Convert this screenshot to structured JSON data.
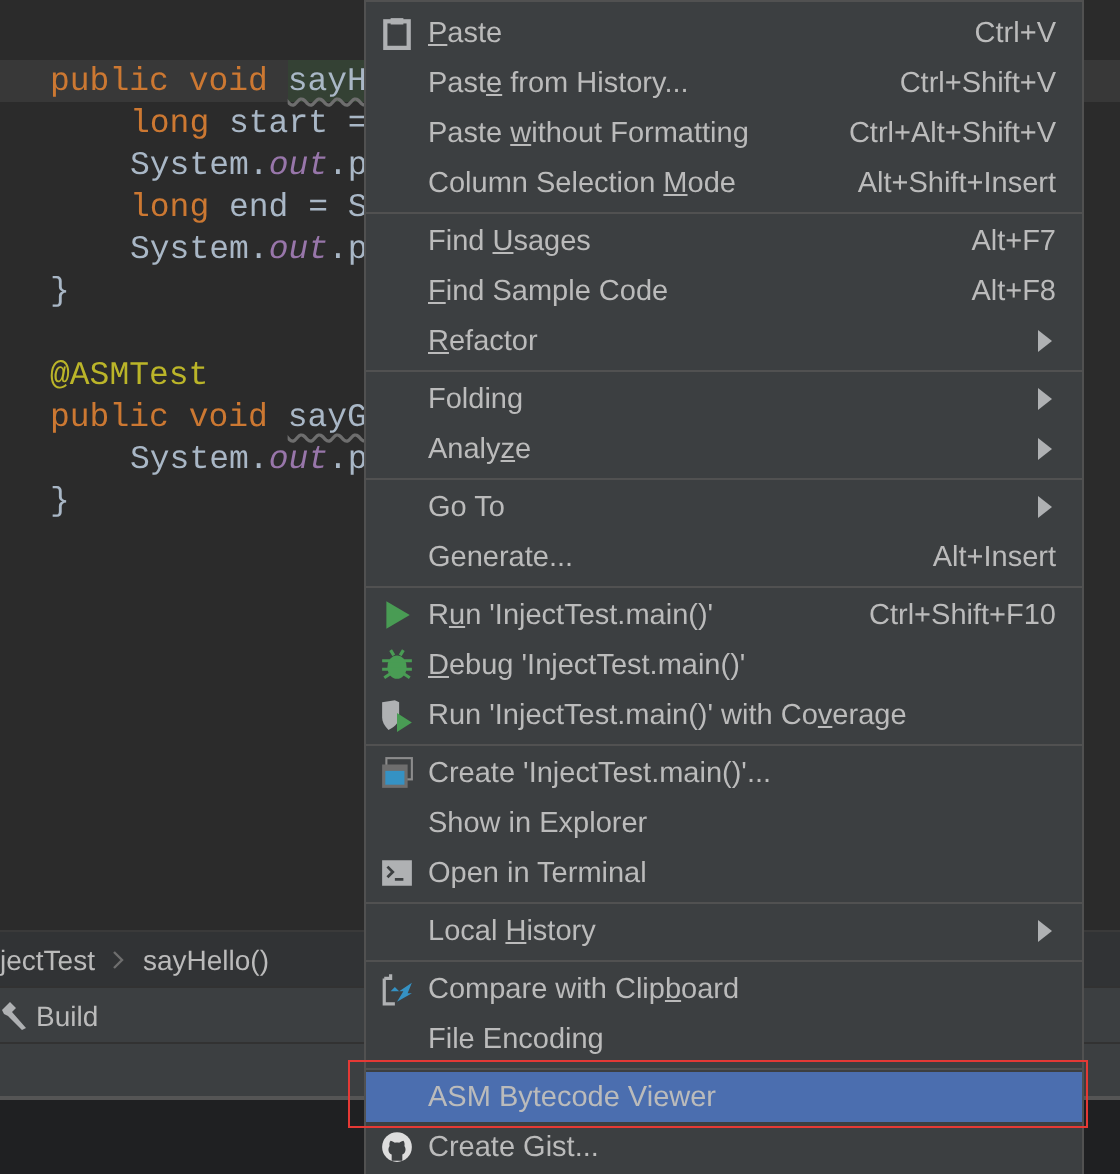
{
  "editor": {
    "lines": [
      {
        "current": true,
        "indented": false,
        "tokens": [
          {
            "kind": "keyword",
            "text": "public"
          },
          {
            "kind": "keyword",
            "text": "void"
          },
          {
            "kind": "unused_hl",
            "text": "sayH"
          }
        ]
      },
      {
        "current": false,
        "indented": true,
        "tokens": [
          {
            "kind": "keyword",
            "text": "long"
          },
          {
            "kind": "plain",
            "text": "start ="
          }
        ]
      },
      {
        "current": false,
        "indented": true,
        "tokens": [
          {
            "kind": "plain",
            "text": "System."
          },
          {
            "kind": "field",
            "text": "out"
          },
          {
            "kind": "plain",
            "text": ".p"
          }
        ]
      },
      {
        "current": false,
        "indented": true,
        "tokens": [
          {
            "kind": "keyword",
            "text": "long"
          },
          {
            "kind": "plain",
            "text": "end = S"
          }
        ]
      },
      {
        "current": false,
        "indented": true,
        "tokens": [
          {
            "kind": "plain",
            "text": "System."
          },
          {
            "kind": "field",
            "text": "out"
          },
          {
            "kind": "plain",
            "text": ".p"
          }
        ]
      },
      {
        "current": false,
        "indented": false,
        "tokens": [
          {
            "kind": "plain",
            "text": "}"
          }
        ]
      },
      {
        "current": false
      },
      {
        "current": false,
        "indented": false,
        "tokens": [
          {
            "kind": "annotation",
            "text": "@ASMTest"
          }
        ]
      },
      {
        "current": false,
        "indented": false,
        "tokens": [
          {
            "kind": "keyword",
            "text": "public"
          },
          {
            "kind": "keyword",
            "text": "void"
          },
          {
            "kind": "unused",
            "text": "sayG"
          }
        ]
      },
      {
        "current": false,
        "indented": true,
        "tokens": [
          {
            "kind": "plain",
            "text": "System."
          },
          {
            "kind": "field",
            "text": "out"
          },
          {
            "kind": "plain",
            "text": ".p"
          }
        ]
      },
      {
        "current": false,
        "indented": false,
        "tokens": [
          {
            "kind": "plain",
            "text": "}"
          }
        ]
      }
    ]
  },
  "breadcrumb": [
    "jectTest",
    "sayHello()"
  ],
  "tool_tab": {
    "label": "Build"
  },
  "menu": {
    "groups": [
      {
        "items": [
          {
            "kind": "clipboard",
            "label": {
              "key": "P",
              "after": "aste"
            },
            "shortcut": "Ctrl+V",
            "submenu": false,
            "selected": false
          },
          {
            "kind": "plain",
            "label": {
              "before": "Past",
              "key": "e",
              "after": " from History..."
            },
            "shortcut": "Ctrl+Shift+V",
            "submenu": false,
            "selected": false
          },
          {
            "kind": "plain",
            "label": {
              "before": "Paste ",
              "key": "w",
              "after": "ithout Formatting"
            },
            "shortcut": "Ctrl+Alt+Shift+V",
            "submenu": false,
            "selected": false
          },
          {
            "kind": "plain",
            "label": {
              "before": "Column Selection ",
              "key": "M",
              "after": "ode"
            },
            "shortcut": "Alt+Shift+Insert",
            "submenu": false,
            "selected": false
          }
        ]
      },
      {
        "items": [
          {
            "kind": "plain",
            "label": {
              "before": "Find ",
              "key": "U",
              "after": "sages"
            },
            "shortcut": "Alt+F7",
            "submenu": false,
            "selected": false
          },
          {
            "kind": "plain",
            "label": {
              "key": "F",
              "after": "ind Sample Code"
            },
            "shortcut": "Alt+F8",
            "submenu": false,
            "selected": false
          },
          {
            "kind": "plain",
            "label": {
              "key": "R",
              "after": "efactor"
            },
            "submenu": true,
            "selected": false
          }
        ]
      },
      {
        "items": [
          {
            "kind": "plain",
            "label": {
              "before": "Folding"
            },
            "submenu": true,
            "selected": false
          },
          {
            "kind": "plain",
            "label": {
              "before": "Analy",
              "key": "z",
              "after": "e"
            },
            "submenu": true,
            "selected": false
          }
        ]
      },
      {
        "items": [
          {
            "kind": "plain",
            "label": {
              "before": "Go To"
            },
            "submenu": true,
            "selected": false
          },
          {
            "kind": "plain",
            "label": {
              "before": "Generate..."
            },
            "shortcut": "Alt+Insert",
            "submenu": false,
            "selected": false
          }
        ]
      },
      {
        "items": [
          {
            "kind": "run",
            "label": {
              "before": "R",
              "key": "u",
              "after": "n 'InjectTest.main()'"
            },
            "shortcut": "Ctrl+Shift+F10",
            "submenu": false,
            "selected": false
          },
          {
            "kind": "debug",
            "label": {
              "key": "D",
              "after": "ebug 'InjectTest.main()'"
            },
            "submenu": false,
            "selected": false
          },
          {
            "kind": "coverage",
            "label": {
              "before": "Run 'InjectTest.main()' with Co",
              "key": "v",
              "after": "erage"
            },
            "submenu": false,
            "selected": false
          }
        ]
      },
      {
        "items": [
          {
            "kind": "window",
            "label": {
              "before": "Create 'InjectTest.main()'..."
            },
            "submenu": false,
            "selected": false
          },
          {
            "kind": "plain",
            "label": {
              "before": "Show in Explorer"
            },
            "submenu": false,
            "selected": false
          },
          {
            "kind": "terminal",
            "label": {
              "before": "Open in Terminal"
            },
            "submenu": false,
            "selected": false
          }
        ]
      },
      {
        "items": [
          {
            "kind": "plain",
            "label": {
              "before": "Local ",
              "key": "H",
              "after": "istory"
            },
            "submenu": true,
            "selected": false
          }
        ]
      },
      {
        "items": [
          {
            "kind": "compare",
            "label": {
              "before": "Compare with Clip",
              "key": "b",
              "after": "oard"
            },
            "submenu": false,
            "selected": false
          },
          {
            "kind": "plain",
            "label": {
              "before": "File Encoding"
            },
            "submenu": false,
            "selected": false
          }
        ]
      },
      {
        "items": [
          {
            "kind": "plain",
            "label": {
              "before": "ASM Bytecode Viewer"
            },
            "submenu": false,
            "selected": true
          },
          {
            "kind": "github",
            "label": {
              "before": "Create Gist..."
            },
            "submenu": false,
            "selected": false
          }
        ]
      }
    ]
  }
}
